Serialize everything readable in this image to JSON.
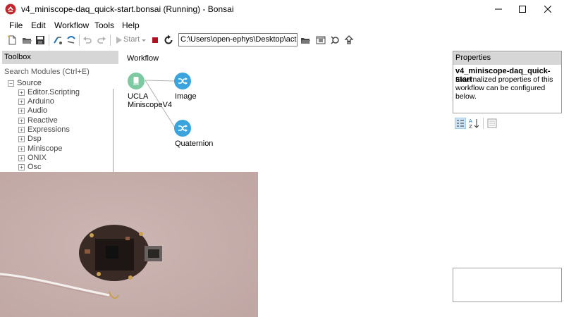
{
  "window": {
    "title": "v4_miniscope-daq_quick-start.bonsai (Running) - Bonsai",
    "minimize_glyph": "—",
    "maximize_glyph": "☐",
    "close_glyph": "✕"
  },
  "menu": [
    "File",
    "Edit",
    "Workflow",
    "Tools",
    "Help"
  ],
  "toolbar": {
    "start_label": "Start",
    "path_value": "C:\\Users\\open-ephys\\Desktop\\active"
  },
  "toolbox": {
    "header": "Toolbox",
    "search_placeholder": "Search Modules (Ctrl+E)",
    "root": "Source",
    "items": [
      "Editor.Scripting",
      "Arduino",
      "Audio",
      "Reactive",
      "Expressions",
      "Dsp",
      "Miniscope",
      "ONIX",
      "Osc"
    ]
  },
  "workflow": {
    "label": "Workflow",
    "nodes": [
      {
        "label_line1": "UCLA",
        "label_line2": "MiniscopeV4",
        "icon": "source-node-icon"
      },
      {
        "label_line1": "Image",
        "label_line2": "",
        "icon": "member-selector-icon"
      },
      {
        "label_line1": "Quaternion",
        "label_line2": "",
        "icon": "member-selector-icon"
      }
    ]
  },
  "properties": {
    "header": "Properties",
    "name": "v4_miniscope-daq_quick-start",
    "description": "Externalized properties of this workflow can be configured below."
  },
  "colors": {
    "source_node": "#7dc9a1",
    "transform_node": "#3ba4dc",
    "panel_header": "#d6d6d6",
    "stop_button": "#b01020",
    "video_background": "#c9b0ad"
  }
}
